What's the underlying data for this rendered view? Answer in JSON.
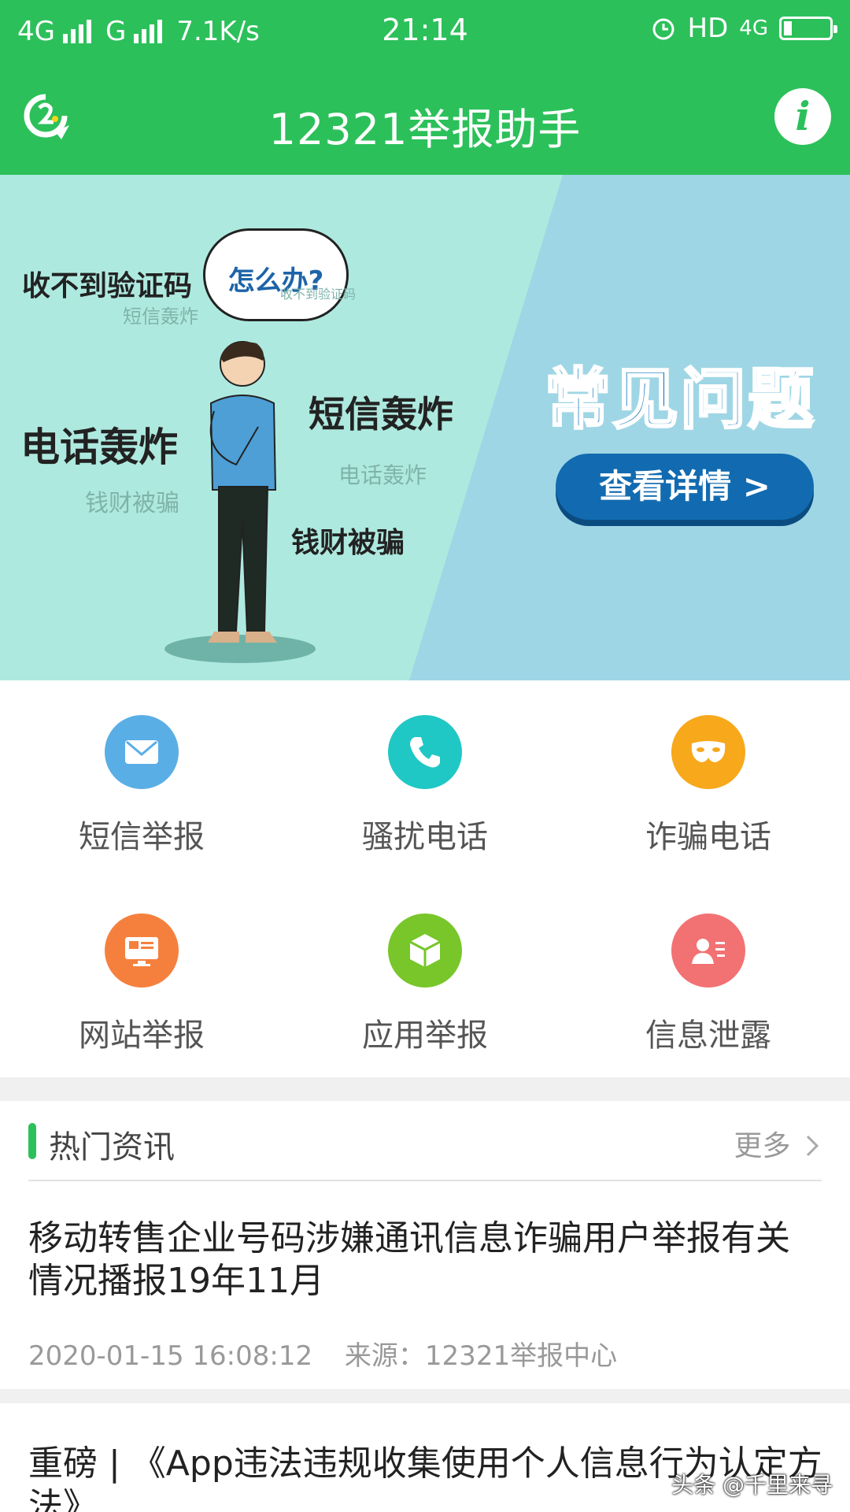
{
  "status_bar": {
    "left": [
      "4G",
      "G",
      "7.1K/s"
    ],
    "time": "21:14",
    "hd": "HD",
    "net": "4G"
  },
  "header": {
    "title": "12321举报助手",
    "info_glyph": "i"
  },
  "banner": {
    "bubble": "怎么办?",
    "words": {
      "w1": "收不到验证码",
      "w2": "短信轰炸",
      "w3": "电话轰炸",
      "w4": "钱财被骗",
      "w5": "收不到验证码",
      "w6": "短信轰炸",
      "w7": "电话轰炸",
      "w8": "钱财被骗"
    },
    "faq_title": "常见问题",
    "faq_button": "查看详情 >"
  },
  "grid": [
    {
      "label": "短信举报",
      "icon": "envelope-icon",
      "color": "#5aaee6"
    },
    {
      "label": "骚扰电话",
      "icon": "phone-icon",
      "color": "#1fc7c5"
    },
    {
      "label": "诈骗电话",
      "icon": "mask-icon",
      "color": "#f7a81b"
    },
    {
      "label": "网站举报",
      "icon": "monitor-icon",
      "color": "#f5803e"
    },
    {
      "label": "应用举报",
      "icon": "box-icon",
      "color": "#78c62a"
    },
    {
      "label": "信息泄露",
      "icon": "id-card-icon",
      "color": "#f27173"
    }
  ],
  "news": {
    "section_title": "热门资讯",
    "more": "更多",
    "items": [
      {
        "title": "移动转售企业号码涉嫌通讯信息诈骗用户举报有关情况播报19年11月",
        "time": "2020-01-15 16:08:12",
        "source": "来源：12321举报中心"
      },
      {
        "title": "重磅 | 《App违法违规收集使用个人信息行为认定方法》"
      }
    ]
  },
  "watermark": "头条 @千里来寻",
  "colors": {
    "brand_green": "#2cc05a",
    "faq_blue": "#126bb0"
  }
}
